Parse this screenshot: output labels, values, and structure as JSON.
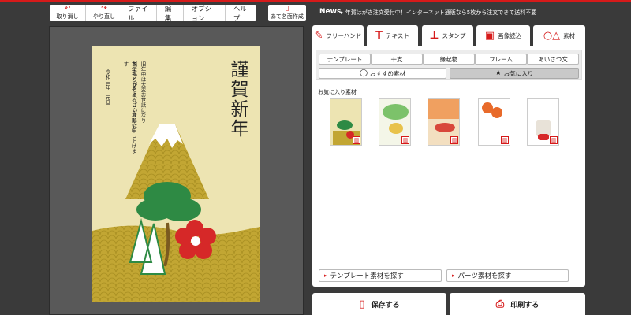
{
  "toolbar": {
    "undo_label": "取り消し",
    "redo_label": "やり直し",
    "menus": [
      "ファイル",
      "編集",
      "オプション",
      "ヘルプ"
    ],
    "address_label": "あて名面作成",
    "news_label": "News",
    "news_text": "▸ 年賀はがき注文受付中！インターネット通販なら5枚から注文できて送料不要"
  },
  "card": {
    "greeting_title": "謹賀新年",
    "message_lines": [
      "旧年中は大変お世話になり",
      "誠にありがとうございました",
      "本年もどうぞよろしくお願い申し上げます"
    ],
    "date_text": "令和三年　元旦"
  },
  "tools": {
    "tabs": [
      "フリーハンド",
      "テキスト",
      "スタンプ",
      "画像読込",
      "素材"
    ],
    "icons": [
      "pen-icon",
      "text-t-icon",
      "stamp-icon",
      "image-icon",
      "shapes-icon"
    ]
  },
  "materials": {
    "categories": [
      "テンプレート",
      "干支",
      "縁起物",
      "フレーム",
      "あいさつ文"
    ],
    "recommended_label": "おすすめ素材",
    "favorites_tab_label": "お気に入り",
    "favorites_title": "お気に入り素材",
    "find_template_label": "テンプレート素材を探す",
    "find_parts_label": "パーツ素材を探す"
  },
  "actions": {
    "save_label": "保存する",
    "print_label": "印刷する"
  },
  "colors": {
    "accent": "#d61a1a",
    "toolbar_bg": "#3a3a3a",
    "card_bg": "#ede4b2"
  }
}
